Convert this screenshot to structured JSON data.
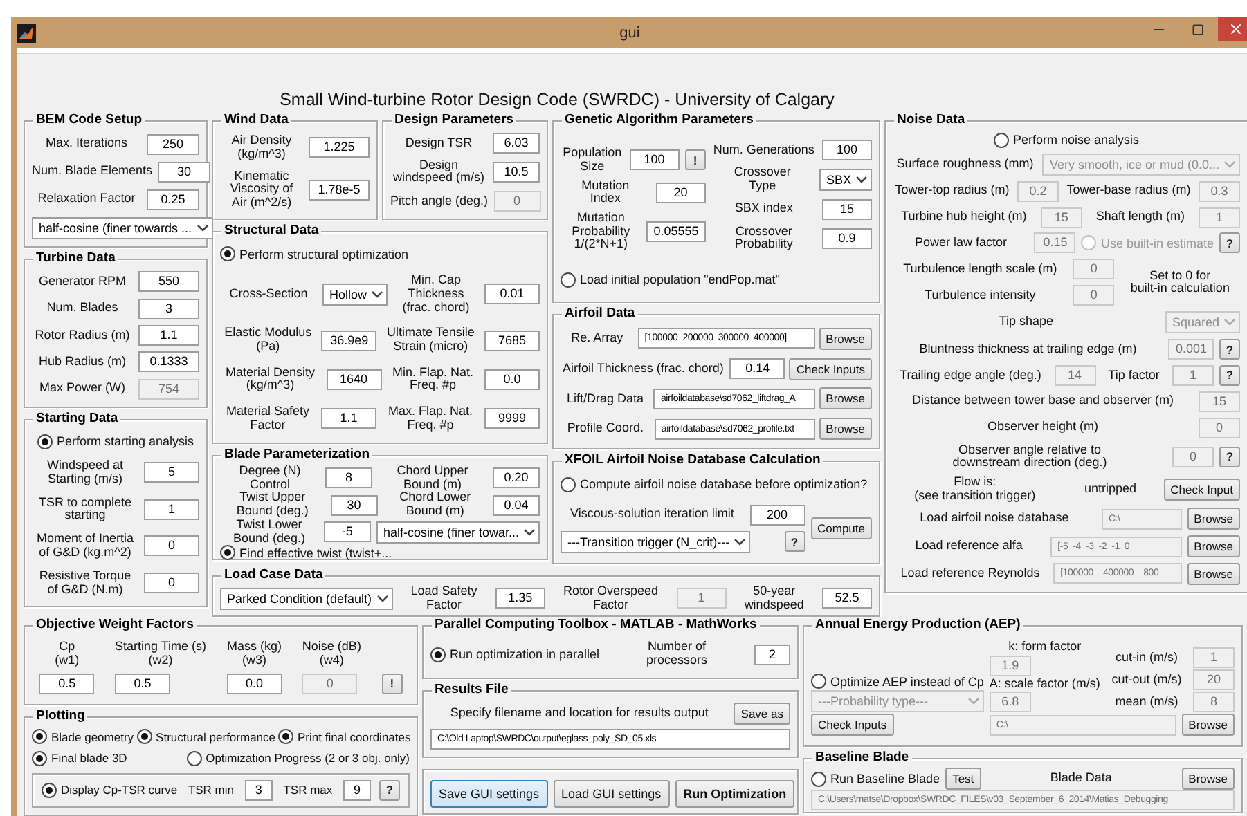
{
  "window": {
    "title": "gui"
  },
  "heading": "Small Wind-turbine Rotor Design Code (SWRDC) - University of Calgary",
  "panels": {
    "bem_code_setup": {
      "title": "BEM Code Setup",
      "rows": [
        [
          {
            "kind": "label",
            "text": "Max. Iterations"
          },
          {
            "kind": "field",
            "value": "250",
            "disabled": false
          }
        ],
        [
          {
            "kind": "label",
            "text": "Num. Blade Elements"
          },
          {
            "kind": "field",
            "value": "30",
            "disabled": false
          }
        ],
        [
          {
            "kind": "label",
            "text": "Relaxation Factor"
          },
          {
            "kind": "field",
            "value": "0.25",
            "disabled": false
          }
        ],
        [
          {
            "kind": "select",
            "value": "half-cosine (finer towards ...",
            "disabled": false
          }
        ]
      ]
    },
    "turbine_data": {
      "title": "Turbine Data",
      "rows": [
        [
          {
            "kind": "label",
            "text": "Generator RPM"
          },
          {
            "kind": "field",
            "value": "550",
            "disabled": false
          }
        ],
        [
          {
            "kind": "label",
            "text": "Num. Blades"
          },
          {
            "kind": "field",
            "value": "3",
            "disabled": false
          }
        ],
        [
          {
            "kind": "label",
            "text": "Rotor Radius (m)"
          },
          {
            "kind": "field",
            "value": "1.1",
            "disabled": false
          }
        ],
        [
          {
            "kind": "label",
            "text": "Hub Radius (m)"
          },
          {
            "kind": "field",
            "value": "0.1333",
            "disabled": false
          }
        ],
        [
          {
            "kind": "label",
            "text": "Max Power (W)"
          },
          {
            "kind": "field",
            "value": "754",
            "disabled": true
          }
        ]
      ]
    },
    "starting_data": {
      "title": "Starting Data",
      "rows": [
        [
          {
            "kind": "radio",
            "label": "Perform starting analysis",
            "selected": true,
            "disabled": false
          }
        ],
        [
          {
            "kind": "label",
            "text": "Windspeed at\nStarting (m/s)"
          },
          {
            "kind": "field",
            "value": "5",
            "disabled": false
          }
        ],
        [
          {
            "kind": "label",
            "text": "TSR to complete\nstarting"
          },
          {
            "kind": "field",
            "value": "1",
            "disabled": false
          }
        ],
        [
          {
            "kind": "label",
            "text": "Moment of Inertia\nof G&D (kg.m^2)"
          },
          {
            "kind": "field",
            "value": "0",
            "disabled": false
          }
        ],
        [
          {
            "kind": "label",
            "text": "Resistive Torque\nof G&D (N.m)"
          },
          {
            "kind": "field",
            "value": "0",
            "disabled": false
          }
        ]
      ]
    },
    "wind_data": {
      "title": "Wind Data",
      "rows": [
        [
          {
            "kind": "label",
            "text": "Air Density\n(kg/m^3)"
          },
          {
            "kind": "field",
            "value": "1.225",
            "disabled": false
          }
        ],
        [
          {
            "kind": "label",
            "text": "Kinematic\nViscosity of\nAir (m^2/s)"
          },
          {
            "kind": "field",
            "value": "1.78e-5",
            "disabled": false
          }
        ]
      ]
    },
    "design_parameters": {
      "title": "Design Parameters",
      "rows": [
        [
          {
            "kind": "label",
            "text": "Design TSR"
          },
          {
            "kind": "field",
            "value": "6.03",
            "disabled": false
          }
        ],
        [
          {
            "kind": "label",
            "text": "Design\nwindspeed (m/s)"
          },
          {
            "kind": "field",
            "value": "10.5",
            "disabled": false
          }
        ],
        [
          {
            "kind": "label",
            "text": "Pitch angle (deg.)"
          },
          {
            "kind": "field",
            "value": "0",
            "disabled": true
          }
        ]
      ]
    },
    "structural_data": {
      "title": "Structural Data",
      "rows": [
        [
          {
            "kind": "radio",
            "label": "Perform structural optimization",
            "selected": true,
            "disabled": false
          }
        ],
        [
          {
            "kind": "label",
            "text": "Cross-Section"
          },
          {
            "kind": "select",
            "value": "Hollow",
            "disabled": false
          },
          {
            "kind": "label",
            "text": "Min. Cap\nThickness\n(frac. chord)"
          },
          {
            "kind": "field",
            "value": "0.01",
            "disabled": false
          }
        ],
        [
          {
            "kind": "label",
            "text": "Elastic Modulus\n(Pa)"
          },
          {
            "kind": "field",
            "value": "36.9e9",
            "disabled": false
          },
          {
            "kind": "label",
            "text": "Ultimate Tensile\nStrain (micro)"
          },
          {
            "kind": "field",
            "value": "7685",
            "disabled": false
          }
        ],
        [
          {
            "kind": "label",
            "text": "Material Density\n(kg/m^3)"
          },
          {
            "kind": "field",
            "value": "1640",
            "disabled": false
          },
          {
            "kind": "label",
            "text": "Min. Flap. Nat.\nFreq. #p"
          },
          {
            "kind": "field",
            "value": "0.0",
            "disabled": false
          }
        ],
        [
          {
            "kind": "label",
            "text": "Material Safety\nFactor"
          },
          {
            "kind": "field",
            "value": "1.1",
            "disabled": false
          },
          {
            "kind": "label",
            "text": "Max. Flap. Nat.\nFreq. #p"
          },
          {
            "kind": "field",
            "value": "9999",
            "disabled": false
          }
        ]
      ]
    },
    "blade_parameterization": {
      "title": "Blade Parameterization",
      "rows": [
        [
          {
            "kind": "label",
            "text": "Degree (N)\nControl"
          },
          {
            "kind": "field",
            "value": "8",
            "disabled": false
          },
          {
            "kind": "label",
            "text": "Chord Upper\nBound (m)"
          },
          {
            "kind": "field",
            "value": "0.20",
            "disabled": false
          }
        ],
        [
          {
            "kind": "label",
            "text": "Twist Upper\nBound (deg.)"
          },
          {
            "kind": "field",
            "value": "30",
            "disabled": false
          },
          {
            "kind": "label",
            "text": "Chord Lower\nBound (m)"
          },
          {
            "kind": "field",
            "value": "0.04",
            "disabled": false
          }
        ],
        [
          {
            "kind": "label",
            "text": "Twist Lower\nBound (deg.)"
          },
          {
            "kind": "field",
            "value": "-5",
            "disabled": false
          },
          {
            "kind": "select",
            "value": "half-cosine (finer towar...",
            "disabled": false
          }
        ],
        [
          {
            "kind": "radio",
            "label": "Find effective twist (twist+...",
            "selected": true,
            "disabled": false
          }
        ]
      ]
    },
    "genetic_algorithm_parameters": {
      "title": "Genetic Algorithm Parameters",
      "rows": [
        [
          {
            "kind": "stack",
            "rows": [
              [
                {
                  "kind": "label",
                  "text": "Population\nSize"
                },
                {
                  "kind": "field",
                  "value": "100",
                  "disabled": false
                },
                {
                  "kind": "help",
                  "label": "!"
                }
              ],
              [
                {
                  "kind": "label",
                  "text": "Mutation\nIndex"
                },
                {
                  "kind": "field",
                  "value": "20",
                  "disabled": false
                }
              ],
              [
                {
                  "kind": "label",
                  "text": "Mutation\nProbability\n1/(2*N+1)"
                },
                {
                  "kind": "field",
                  "value": "0.05555",
                  "disabled": false
                }
              ]
            ]
          },
          {
            "kind": "stack",
            "rows": [
              [
                {
                  "kind": "label",
                  "text": "Num. Generations"
                },
                {
                  "kind": "field",
                  "value": "100",
                  "disabled": false
                }
              ],
              [
                {
                  "kind": "label",
                  "text": "Crossover\nType"
                },
                {
                  "kind": "select",
                  "value": "SBX",
                  "disabled": false
                }
              ],
              [
                {
                  "kind": "label",
                  "text": "SBX index"
                },
                {
                  "kind": "field",
                  "value": "15",
                  "disabled": false
                }
              ],
              [
                {
                  "kind": "label",
                  "text": "Crossover\nProbability"
                },
                {
                  "kind": "field",
                  "value": "0.9",
                  "disabled": false
                }
              ]
            ]
          }
        ],
        [
          {
            "kind": "radio",
            "label": "Load initial population \"endPop.mat\"",
            "selected": false,
            "disabled": false
          }
        ]
      ]
    },
    "airfoil_data": {
      "title": "Airfoil Data",
      "rows": [
        [
          {
            "kind": "label",
            "text": "Re. Array"
          },
          {
            "kind": "path",
            "value": "[100000  200000  300000  400000]",
            "disabled": false
          },
          {
            "kind": "button",
            "label": "Browse"
          }
        ],
        [
          {
            "kind": "label",
            "text": "Airfoil Thickness (frac. chord)"
          },
          {
            "kind": "field",
            "value": "0.14",
            "disabled": false
          },
          {
            "kind": "button",
            "label": "Check Inputs"
          }
        ],
        [
          {
            "kind": "label",
            "text": "Lift/Drag Data"
          },
          {
            "kind": "path",
            "value": "airfoildatabase\\sd7062_liftdrag_A",
            "disabled": false
          },
          {
            "kind": "button",
            "label": "Browse"
          }
        ],
        [
          {
            "kind": "label",
            "text": "Profile Coord."
          },
          {
            "kind": "path",
            "value": "airfoildatabase\\sd7062_profile.txt",
            "disabled": false
          },
          {
            "kind": "button",
            "label": "Browse"
          }
        ]
      ]
    },
    "xfoil_airfoil_noise_database_calculation": {
      "title": "XFOIL Airfoil Noise Database Calculation",
      "rows": [
        [
          {
            "kind": "radio",
            "label": "Compute airfoil noise database before optimization?",
            "selected": false,
            "disabled": false
          }
        ],
        [
          {
            "kind": "stack",
            "rows": [
              [
                {
                  "kind": "label",
                  "text": "Viscous-solution iteration limit"
                },
                {
                  "kind": "field",
                  "value": "200",
                  "disabled": false
                }
              ],
              [
                {
                  "kind": "select",
                  "value": "---Transition trigger (N_crit)---",
                  "disabled": false
                },
                {
                  "kind": "help",
                  "label": "?"
                }
              ]
            ]
          },
          {
            "kind": "button",
            "label": "Compute"
          }
        ]
      ]
    },
    "load_case_data": {
      "title": "Load Case Data",
      "rows": [
        [
          {
            "kind": "select",
            "value": "Parked Condition (default)",
            "disabled": false
          },
          {
            "kind": "label",
            "text": "Load Safety\nFactor"
          },
          {
            "kind": "field",
            "value": "1.35",
            "disabled": false
          },
          {
            "kind": "label",
            "text": "Rotor Overspeed\nFactor"
          },
          {
            "kind": "field",
            "value": "1",
            "disabled": true
          },
          {
            "kind": "label",
            "text": "50-year\nwindspeed"
          },
          {
            "kind": "field",
            "value": "52.5",
            "disabled": false
          }
        ]
      ]
    },
    "noise_data": {
      "title": "Noise Data",
      "rows": [
        [
          {
            "kind": "radio",
            "label": "Perform noise analysis",
            "selected": false,
            "disabled": false
          }
        ],
        [
          {
            "kind": "label",
            "text": "Surface roughness (mm)"
          },
          {
            "kind": "select",
            "value": "Very smooth, ice or mud (0.0...",
            "disabled": true
          }
        ],
        [
          {
            "kind": "label",
            "text": "Tower-top radius (m)"
          },
          {
            "kind": "field",
            "value": "0.2",
            "disabled": true
          },
          {
            "kind": "label",
            "text": "Tower-base radius (m)"
          },
          {
            "kind": "field",
            "value": "0.3",
            "disabled": true
          }
        ],
        [
          {
            "kind": "label",
            "text": "Turbine hub height (m)"
          },
          {
            "kind": "field",
            "value": "15",
            "disabled": true
          },
          {
            "kind": "label",
            "text": "Shaft length (m)"
          },
          {
            "kind": "field",
            "value": "1",
            "disabled": true
          }
        ],
        [
          {
            "kind": "label",
            "text": "Power law factor"
          },
          {
            "kind": "field",
            "value": "0.15",
            "disabled": true
          },
          {
            "kind": "radio",
            "label": "Use built-in estimate",
            "selected": false,
            "disabled": true
          },
          {
            "kind": "help",
            "label": "?"
          }
        ],
        [
          {
            "kind": "stack",
            "rows": [
              [
                {
                  "kind": "label",
                  "text": "Turbulence length scale (m)"
                },
                {
                  "kind": "field",
                  "value": "0",
                  "disabled": true
                }
              ],
              [
                {
                  "kind": "label",
                  "text": "Turbulence intensity"
                },
                {
                  "kind": "field",
                  "value": "0",
                  "disabled": true
                }
              ]
            ]
          },
          {
            "kind": "label",
            "text": "Set to 0 for\nbuilt-in calculation"
          }
        ],
        [
          {
            "kind": "label",
            "text": "Tip shape"
          },
          {
            "kind": "select",
            "value": "Squared",
            "disabled": true
          }
        ],
        [
          {
            "kind": "label",
            "text": "Bluntness thickness at trailing edge (m)"
          },
          {
            "kind": "field",
            "value": "0.001",
            "disabled": true
          },
          {
            "kind": "help",
            "label": "?"
          }
        ],
        [
          {
            "kind": "label",
            "text": "Trailing edge angle (deg.)"
          },
          {
            "kind": "field",
            "value": "14",
            "disabled": true
          },
          {
            "kind": "label",
            "text": "Tip factor"
          },
          {
            "kind": "field",
            "value": "1",
            "disabled": true
          },
          {
            "kind": "help",
            "label": "?"
          }
        ],
        [
          {
            "kind": "label",
            "text": "Distance between tower base and observer (m)"
          },
          {
            "kind": "field",
            "value": "15",
            "disabled": true
          }
        ],
        [
          {
            "kind": "label",
            "text": "Observer height (m)"
          },
          {
            "kind": "field",
            "value": "0",
            "disabled": true
          }
        ],
        [
          {
            "kind": "label",
            "text": "Observer angle relative to\ndownstream direction (deg.)"
          },
          {
            "kind": "field",
            "value": "0",
            "disabled": true
          },
          {
            "kind": "help",
            "label": "?"
          }
        ],
        [
          {
            "kind": "label",
            "text": "Flow is:\n(see transition trigger)"
          },
          {
            "kind": "label",
            "text": "untripped"
          },
          {
            "kind": "button",
            "label": "Check Input"
          }
        ],
        [
          {
            "kind": "label",
            "text": "Load airfoil noise database"
          },
          {
            "kind": "path",
            "value": "C:\\",
            "disabled": true
          },
          {
            "kind": "button",
            "label": "Browse"
          }
        ],
        [
          {
            "kind": "label",
            "text": "Load reference alfa"
          },
          {
            "kind": "path",
            "value": "[-5  -4  -3  -2  -1  0",
            "disabled": true
          },
          {
            "kind": "button",
            "label": "Browse"
          }
        ],
        [
          {
            "kind": "label",
            "text": "Load reference Reynolds"
          },
          {
            "kind": "path",
            "value": "[100000    400000    800",
            "disabled": true
          },
          {
            "kind": "button",
            "label": "Browse"
          }
        ]
      ]
    },
    "objective_weight_factors": {
      "title": "Objective Weight Factors",
      "rows": [
        [
          {
            "kind": "stack",
            "rows": [
              [
                {
                  "kind": "label",
                  "text": "Cp\n(w1)"
                }
              ],
              [
                {
                  "kind": "field",
                  "value": "0.5",
                  "disabled": false
                }
              ]
            ]
          },
          {
            "kind": "stack",
            "rows": [
              [
                {
                  "kind": "label",
                  "text": "Starting Time (s)\n(w2)"
                }
              ],
              [
                {
                  "kind": "field",
                  "value": "0.5",
                  "disabled": false
                }
              ]
            ]
          },
          {
            "kind": "stack",
            "rows": [
              [
                {
                  "kind": "label",
                  "text": "Mass (kg)\n(w3)"
                }
              ],
              [
                {
                  "kind": "field",
                  "value": "0.0",
                  "disabled": false
                }
              ]
            ]
          },
          {
            "kind": "stack",
            "rows": [
              [
                {
                  "kind": "label",
                  "text": "Noise (dB)\n(w4)"
                }
              ],
              [
                {
                  "kind": "field",
                  "value": "0",
                  "disabled": true
                }
              ]
            ]
          },
          {
            "kind": "help",
            "label": "!"
          }
        ]
      ]
    },
    "plotting": {
      "title": "Plotting",
      "rows": [
        [
          {
            "kind": "radio",
            "label": "Blade geometry",
            "selected": true,
            "disabled": false
          },
          {
            "kind": "radio",
            "label": "Structural performance",
            "selected": true,
            "disabled": false
          },
          {
            "kind": "radio",
            "label": "Print final coordinates",
            "selected": true,
            "disabled": false
          }
        ],
        [
          {
            "kind": "radio",
            "label": "Final blade 3D",
            "selected": true,
            "disabled": false
          },
          {
            "kind": "radio",
            "label": "Optimization Progress (2 or 3 obj. only)",
            "selected": false,
            "disabled": false
          }
        ],
        [
          {
            "kind": "box",
            "rows": [
              [
                {
                  "kind": "radio",
                  "label": "Display Cp-TSR curve",
                  "selected": true,
                  "disabled": false
                },
                {
                  "kind": "label",
                  "text": "TSR min"
                },
                {
                  "kind": "field",
                  "value": "3",
                  "disabled": false
                },
                {
                  "kind": "label",
                  "text": "TSR max"
                },
                {
                  "kind": "field",
                  "value": "9",
                  "disabled": false
                },
                {
                  "kind": "help",
                  "label": "?"
                }
              ]
            ]
          }
        ]
      ]
    },
    "parallel_computing_toolbox": {
      "title": "Parallel Computing Toolbox - MATLAB - MathWorks",
      "rows": [
        [
          {
            "kind": "radio",
            "label": "Run optimization in parallel",
            "selected": true,
            "disabled": false
          },
          {
            "kind": "label",
            "text": "Number of\nprocessors"
          },
          {
            "kind": "field",
            "value": "2",
            "disabled": false
          }
        ]
      ]
    },
    "results_file": {
      "title": "Results File",
      "rows": [
        [
          {
            "kind": "label",
            "text": "Specify filename and location for results output"
          },
          {
            "kind": "button",
            "label": "Save as"
          }
        ],
        [
          {
            "kind": "path",
            "value": "C:\\Old Laptop\\SWRDC\\output\\eglass_poly_SD_05.xls",
            "disabled": false
          }
        ]
      ]
    },
    "settings_actions": {
      "rows": [
        [
          {
            "kind": "button",
            "label": "Save GUI settings",
            "focused": true
          },
          {
            "kind": "button",
            "label": "Load GUI settings",
            "focused": false
          },
          {
            "kind": "strong-button",
            "label": "Run Optimization",
            "focused": false
          }
        ]
      ]
    },
    "annual_energy_production": {
      "title": "Annual Energy Production (AEP)",
      "rows": [
        [
          {
            "kind": "stack",
            "rows": [
              [
                {
                  "kind": "radio",
                  "label": "Optimize AEP instead of Cp",
                  "selected": false,
                  "disabled": false
                }
              ],
              [
                {
                  "kind": "select",
                  "value": "---Probability type---",
                  "disabled": true
                }
              ],
              [
                {
                  "kind": "button",
                  "label": "Check Inputs"
                }
              ]
            ]
          },
          {
            "kind": "stack",
            "rows": [
              [
                {
                  "kind": "stack",
                  "rows": [
                    [
                      {
                        "kind": "label",
                        "text": "k: form factor"
                      }
                    ],
                    [
                      {
                        "kind": "field",
                        "value": "1.9",
                        "disabled": true
                      }
                    ],
                    [
                      {
                        "kind": "label",
                        "text": "A: scale factor (m/s)"
                      }
                    ],
                    [
                      {
                        "kind": "field",
                        "value": "6.8",
                        "disabled": true
                      }
                    ]
                  ]
                },
                {
                  "kind": "stack",
                  "rows": [
                    [
                      {
                        "kind": "label",
                        "text": "cut-in (m/s)"
                      },
                      {
                        "kind": "field",
                        "value": "1",
                        "disabled": true
                      }
                    ],
                    [
                      {
                        "kind": "label",
                        "text": "cut-out (m/s)"
                      },
                      {
                        "kind": "field",
                        "value": "20",
                        "disabled": true
                      }
                    ],
                    [
                      {
                        "kind": "label",
                        "text": "mean (m/s)"
                      },
                      {
                        "kind": "field",
                        "value": "8",
                        "disabled": true
                      }
                    ]
                  ]
                }
              ],
              [
                {
                  "kind": "path",
                  "value": "C:\\",
                  "disabled": true
                },
                {
                  "kind": "button",
                  "label": "Browse"
                }
              ]
            ]
          }
        ]
      ]
    },
    "baseline_blade": {
      "title": "Baseline Blade",
      "rows": [
        [
          {
            "kind": "radio",
            "label": "Run Baseline Blade",
            "selected": false,
            "disabled": false
          },
          {
            "kind": "button",
            "label": "Test"
          },
          {
            "kind": "label",
            "text": "Blade Data"
          },
          {
            "kind": "button",
            "label": "Browse"
          }
        ],
        [
          {
            "kind": "path",
            "value": "C:\\Users\\matse\\Dropbox\\SWRDC_FILES\\v03_September_6_2014\\Matias_Debugging",
            "disabled": true
          }
        ]
      ]
    }
  }
}
